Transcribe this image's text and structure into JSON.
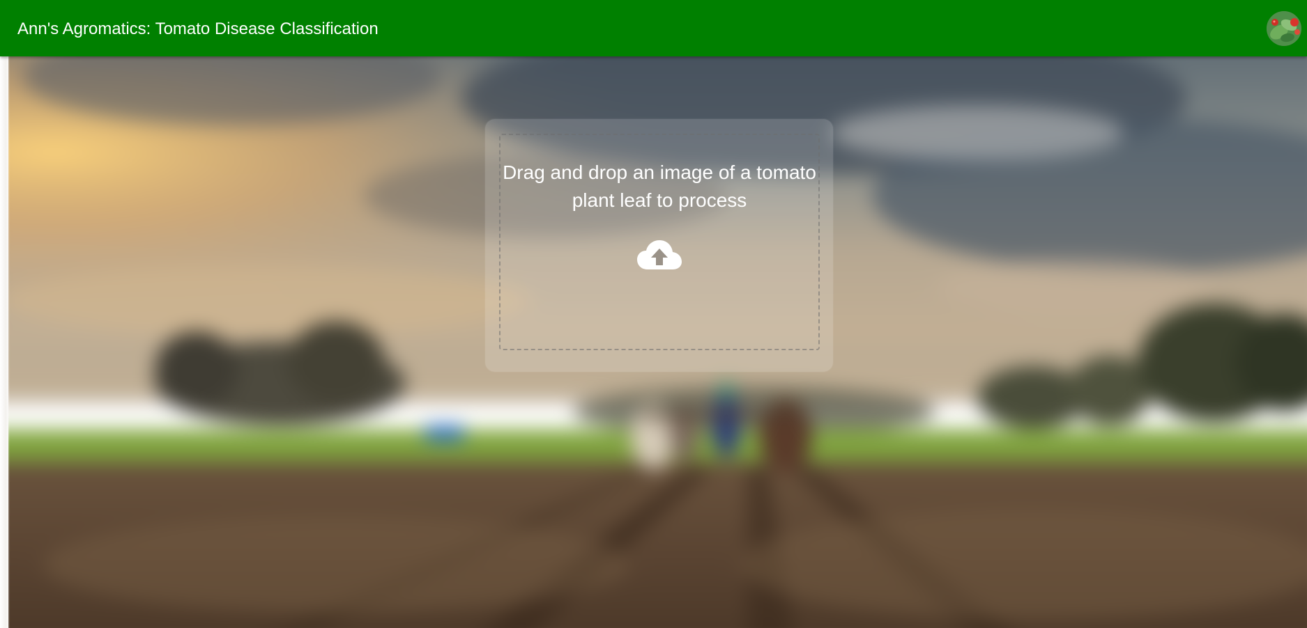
{
  "appbar": {
    "title": "Ann's Agromatics: Tomato Disease Classification",
    "background_color": "#008000",
    "avatar_icon": "tomato-plant-avatar"
  },
  "dropzone": {
    "prompt": "Drag and drop an image of a tomato plant leaf to process",
    "icon": "cloud-upload-icon"
  },
  "background": {
    "icon": "blurred-farm-field-photo"
  }
}
